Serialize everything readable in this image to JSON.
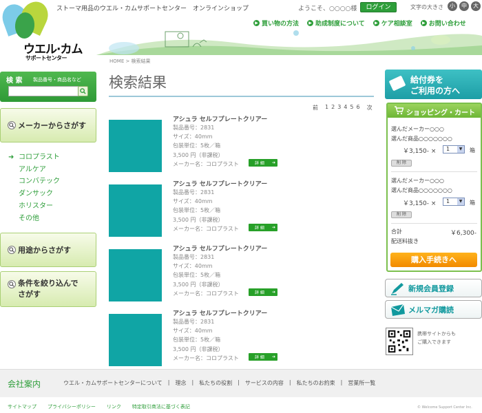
{
  "header": {
    "logo_main": "ウエル·カム",
    "logo_sub": "サポートセンター",
    "tagline": "ストーマ用品のウエル・カムサポートセンター　オンラインショップ",
    "welcome": "ようこそ、○○○○様",
    "login_label": "ログイン",
    "font_size_label": "文字の大きさ",
    "font_sizes": [
      "小",
      "中",
      "大"
    ],
    "nav": [
      "買い物の方法",
      "助成制度について",
      "ケア相談室",
      "お問い合わせ"
    ]
  },
  "colors": {
    "brand_green": "#2e9e3a",
    "teal": "#10a5a5",
    "orange": "#f28a00"
  },
  "sidebar": {
    "search_title": "検 索",
    "search_hint": "製品番号・商品名など",
    "search_value": "",
    "maker_panel": "メーカーからさがす",
    "makers": [
      "コロプラスト",
      "アルケア",
      "コンバテック",
      "ダンサック",
      "ホリスター",
      "その他"
    ],
    "usage_panel": "用途からさがす",
    "filter_panel_1": "条件を絞り込んで",
    "filter_panel_2": "さがす"
  },
  "main": {
    "breadcrumb": "HOME > 検索結果",
    "title": "検索結果",
    "pager_prev": "前",
    "pages": [
      "1",
      "2",
      "3",
      "4",
      "5",
      "6"
    ],
    "pager_next": "次",
    "products": [
      {
        "name": "アシュラ セルフプレートクリアー",
        "number": "製品番号：2831",
        "size": "サイズ：40mm",
        "pack": "包装単位：5枚／箱",
        "price": "3,500 円（非課税）",
        "maker": "メーカー名：コロプラスト",
        "detail": "詳 細"
      },
      {
        "name": "アシュラ セルフプレートクリアー",
        "number": "製品番号：2831",
        "size": "サイズ：40mm",
        "pack": "包装単位：5枚／箱",
        "price": "3,500 円（非課税）",
        "maker": "メーカー名：コロプラスト",
        "detail": "詳 細"
      },
      {
        "name": "アシュラ セルフプレートクリアー",
        "number": "製品番号：2831",
        "size": "サイズ：40mm",
        "pack": "包装単位：5枚／箱",
        "price": "3,500 円（非課税）",
        "maker": "メーカー名：コロプラスト",
        "detail": "詳 細"
      },
      {
        "name": "アシュラ セルフプレートクリアー",
        "number": "製品番号：2831",
        "size": "サイズ：40mm",
        "pack": "包装単位：5枚／箱",
        "price": "3,500 円（非課税）",
        "maker": "メーカー名：コロプラスト",
        "detail": "詳 細"
      }
    ]
  },
  "right": {
    "voucher_1": "給付券を",
    "voucher_2": "ご利用の方へ",
    "cart_title": "ショッピング・カート",
    "cart_items": [
      {
        "maker": "選んだメーカー○○○",
        "product": "選んだ商品○○○○○○○",
        "price": "￥3,150- ×",
        "qty": "1",
        "unit": "箱",
        "delete": "削 除"
      },
      {
        "maker": "選んだメーカー○○○",
        "product": "選んだ商品○○○○○○○",
        "price": "￥3,150- ×",
        "qty": "1",
        "unit": "箱",
        "delete": "削 除"
      }
    ],
    "total_label": "合計",
    "total_value": "￥6,300-",
    "shipping": "配送料抜き",
    "checkout": "購入手続きへ",
    "register": "新規会員登録",
    "newsletter": "メルマガ購読",
    "mobile_1": "携帯サイトからも",
    "mobile_2": "ご購入できます"
  },
  "footer": {
    "title": "会社案内",
    "links": [
      "ウエル・カムサポートセンターについて",
      "|",
      "理念",
      "|",
      "私たちの役割",
      "|",
      "サービスの内容",
      "|",
      "私たちのお約束",
      "|",
      "営業所一覧"
    ],
    "bottom_links": [
      "サイトマップ",
      "プライバシーポリシー",
      "リンク",
      "特定取引商法に基づく表記"
    ],
    "copyright": "© Welcome Support Center Inc."
  }
}
